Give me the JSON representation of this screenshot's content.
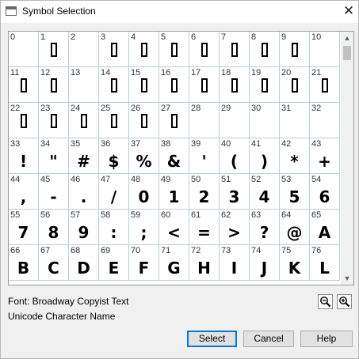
{
  "window": {
    "title": "Symbol Selection",
    "close_glyph": "✕"
  },
  "grid": {
    "cells": [
      {
        "code": "0",
        "glyph": ""
      },
      {
        "code": "1",
        "glyph": "□"
      },
      {
        "code": "2",
        "glyph": ""
      },
      {
        "code": "3",
        "glyph": "□"
      },
      {
        "code": "4",
        "glyph": "□"
      },
      {
        "code": "5",
        "glyph": "□"
      },
      {
        "code": "6",
        "glyph": "□"
      },
      {
        "code": "7",
        "glyph": "□"
      },
      {
        "code": "8",
        "glyph": "□"
      },
      {
        "code": "9",
        "glyph": "□"
      },
      {
        "code": "10",
        "glyph": ""
      },
      {
        "code": "11",
        "glyph": "□"
      },
      {
        "code": "12",
        "glyph": "□"
      },
      {
        "code": "13",
        "glyph": ""
      },
      {
        "code": "14",
        "glyph": "□"
      },
      {
        "code": "15",
        "glyph": "□"
      },
      {
        "code": "16",
        "glyph": "□"
      },
      {
        "code": "17",
        "glyph": "□"
      },
      {
        "code": "18",
        "glyph": "□"
      },
      {
        "code": "19",
        "glyph": "□"
      },
      {
        "code": "20",
        "glyph": "□"
      },
      {
        "code": "21",
        "glyph": "□"
      },
      {
        "code": "22",
        "glyph": "□"
      },
      {
        "code": "23",
        "glyph": "□"
      },
      {
        "code": "24",
        "glyph": "□"
      },
      {
        "code": "25",
        "glyph": "□"
      },
      {
        "code": "26",
        "glyph": "□"
      },
      {
        "code": "27",
        "glyph": "□"
      },
      {
        "code": "28",
        "glyph": ""
      },
      {
        "code": "29",
        "glyph": ""
      },
      {
        "code": "30",
        "glyph": ""
      },
      {
        "code": "31",
        "glyph": ""
      },
      {
        "code": "32",
        "glyph": ""
      },
      {
        "code": "33",
        "glyph": "!"
      },
      {
        "code": "34",
        "glyph": "\""
      },
      {
        "code": "35",
        "glyph": "#"
      },
      {
        "code": "36",
        "glyph": "$"
      },
      {
        "code": "37",
        "glyph": "%"
      },
      {
        "code": "38",
        "glyph": "&"
      },
      {
        "code": "39",
        "glyph": "'"
      },
      {
        "code": "40",
        "glyph": "("
      },
      {
        "code": "41",
        "glyph": ")"
      },
      {
        "code": "42",
        "glyph": "*"
      },
      {
        "code": "43",
        "glyph": "+"
      },
      {
        "code": "44",
        "glyph": ","
      },
      {
        "code": "45",
        "glyph": "-"
      },
      {
        "code": "46",
        "glyph": "."
      },
      {
        "code": "47",
        "glyph": "/"
      },
      {
        "code": "48",
        "glyph": "0"
      },
      {
        "code": "49",
        "glyph": "1"
      },
      {
        "code": "50",
        "glyph": "2"
      },
      {
        "code": "51",
        "glyph": "3"
      },
      {
        "code": "52",
        "glyph": "4"
      },
      {
        "code": "53",
        "glyph": "5"
      },
      {
        "code": "54",
        "glyph": "6"
      },
      {
        "code": "55",
        "glyph": "7"
      },
      {
        "code": "56",
        "glyph": "8"
      },
      {
        "code": "57",
        "glyph": "9"
      },
      {
        "code": "58",
        "glyph": ":"
      },
      {
        "code": "59",
        "glyph": ";"
      },
      {
        "code": "60",
        "glyph": "<"
      },
      {
        "code": "61",
        "glyph": "="
      },
      {
        "code": "62",
        "glyph": ">"
      },
      {
        "code": "63",
        "glyph": "?"
      },
      {
        "code": "64",
        "glyph": "@"
      },
      {
        "code": "65",
        "glyph": "A"
      },
      {
        "code": "66",
        "glyph": "B"
      },
      {
        "code": "67",
        "glyph": "C"
      },
      {
        "code": "68",
        "glyph": "D"
      },
      {
        "code": "69",
        "glyph": "E"
      },
      {
        "code": "70",
        "glyph": "F"
      },
      {
        "code": "71",
        "glyph": "G"
      },
      {
        "code": "72",
        "glyph": "H"
      },
      {
        "code": "73",
        "glyph": "I"
      },
      {
        "code": "74",
        "glyph": "J"
      },
      {
        "code": "75",
        "glyph": "K"
      },
      {
        "code": "76",
        "glyph": "L"
      }
    ]
  },
  "scrollbar": {
    "up_glyph": "▲",
    "down_glyph": "▼"
  },
  "info": {
    "font_label": "Font:  Broadway Copyist Text",
    "unicode_label": "Unicode Character Name"
  },
  "zoom": {
    "out_icon": "zoom-out-icon",
    "in_icon": "zoom-in-icon"
  },
  "buttons": {
    "select": "Select",
    "cancel": "Cancel",
    "help": "Help"
  },
  "colors": {
    "grid_line": "#b8cfe0",
    "primary_border": "#0078d7"
  }
}
